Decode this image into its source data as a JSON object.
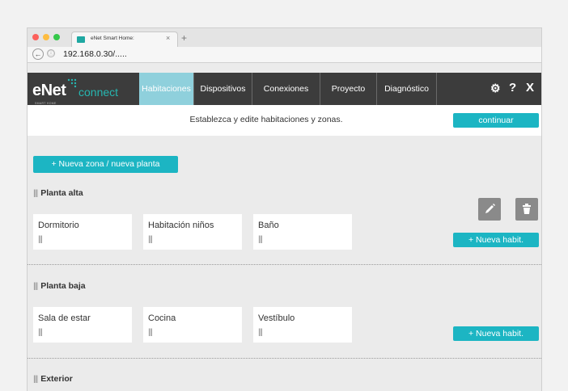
{
  "browser": {
    "tab_title": "eNet Smart Home:",
    "tab_close": "×",
    "new_tab": "+",
    "back_icon": "←",
    "info_icon": "ⓘ",
    "url": "192.168.0.30/....."
  },
  "header": {
    "logo_main": "eNet",
    "logo_sub": "SMART HOME",
    "logo_connect": "connect",
    "tabs": [
      {
        "label": "Habitaciones",
        "active": true
      },
      {
        "label": "Dispositivos",
        "active": false
      },
      {
        "label": "Conexiones",
        "active": false
      },
      {
        "label": "Proyecto",
        "active": false
      },
      {
        "label": "Diagnóstico",
        "active": false
      }
    ],
    "settings_icon": "⚙",
    "help_label": "?",
    "close_label": "X"
  },
  "subbar": {
    "text": "Establezca y edite habitaciones y zonas.",
    "continue_label": "continuar"
  },
  "main": {
    "new_zone_label": "+ Nueva zona / nueva planta",
    "handle": "|||",
    "sections": [
      {
        "title": "Planta alta",
        "rooms": [
          "Dormitorio",
          "Habitación niños",
          "Baño"
        ],
        "new_room_label": "+ Nueva habit."
      },
      {
        "title": "Planta baja",
        "rooms": [
          "Sala de estar",
          "Cocina",
          "Vestíbulo"
        ],
        "new_room_label": "+ Nueva habit."
      },
      {
        "title": "Exterior"
      }
    ]
  },
  "colors": {
    "accent": "#1cb5c3",
    "active_tab": "#8fd0dc",
    "header_bg": "#3c3c3c"
  }
}
